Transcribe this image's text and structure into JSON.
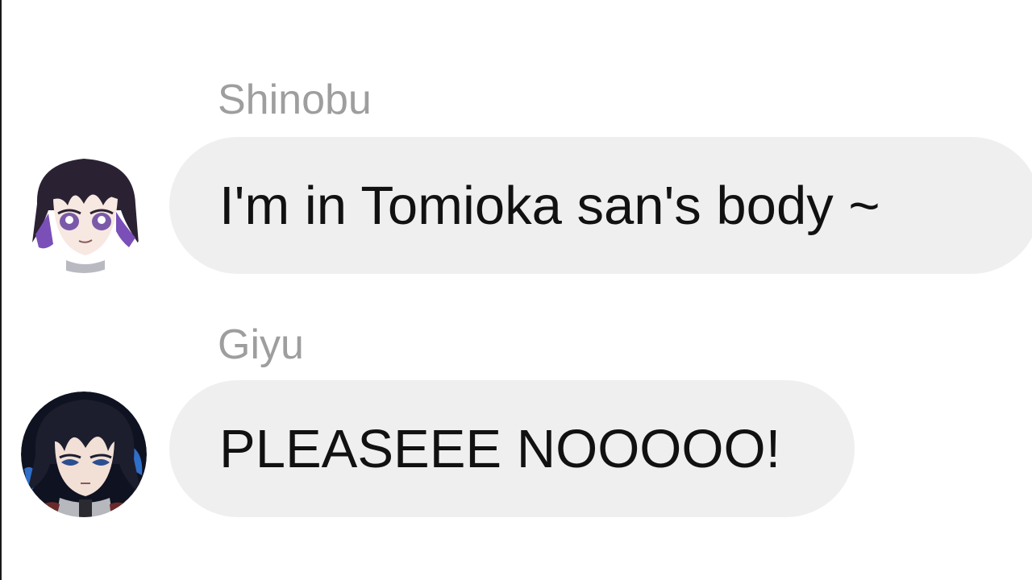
{
  "chat": {
    "messages": [
      {
        "sender": "Shinobu",
        "text": "I'm in Tomioka san's body ~",
        "avatar_icon": "shinobu-avatar-icon",
        "avatar_colors": {
          "hair": "#2a2233",
          "accent": "#7b4fb8",
          "skin": "#f7e8e2",
          "eyes": "#7a5aa8"
        }
      },
      {
        "sender": "Giyu",
        "text": "PLEASEEE NOOOOO!",
        "avatar_icon": "giyu-avatar-icon",
        "avatar_colors": {
          "hair": "#1c1e2e",
          "accent": "#2f6fc8",
          "skin": "#f2dfd6",
          "eyes": "#2b4f8f"
        }
      }
    ],
    "colors": {
      "bubble": "#efefef",
      "sender_name": "#9e9e9e",
      "message_text": "#111111",
      "background": "#ffffff"
    }
  }
}
